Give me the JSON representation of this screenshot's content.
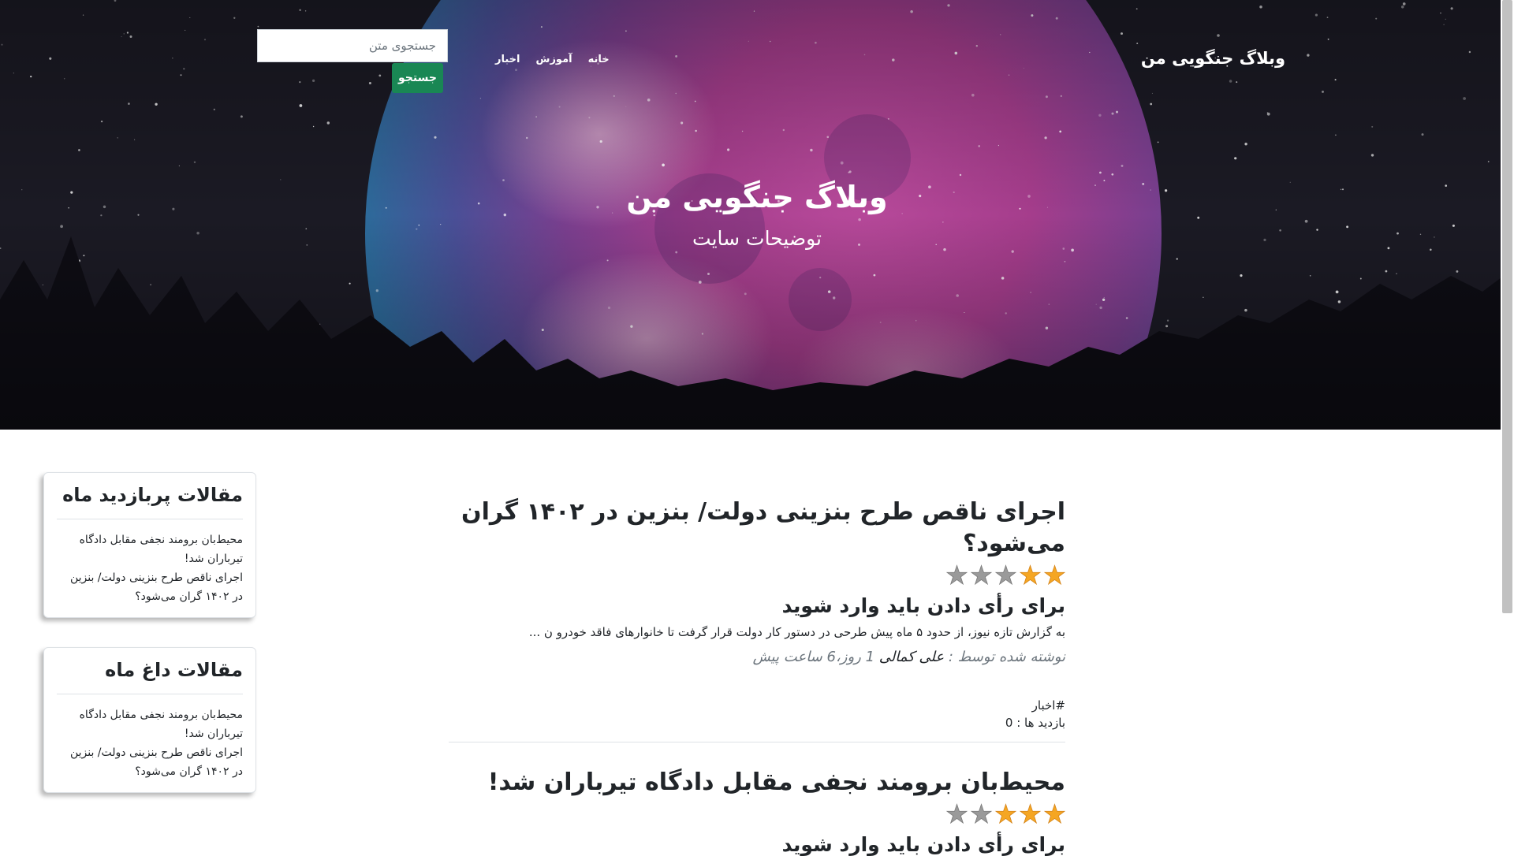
{
  "header": {
    "brand": "وبلاگ جنگویی من",
    "nav": [
      "خانه",
      "آموزش",
      "اخبار"
    ],
    "search_placeholder": "جستجوی متن",
    "search_button": "جستجو"
  },
  "hero": {
    "title": "وبلاگ جنگویی من",
    "subtitle": "توضیحات سایت"
  },
  "colors": {
    "search_button": "#198754",
    "star_filled": "#f5a623",
    "star_empty": "#9a9a9a"
  },
  "sidebar": [
    {
      "title": "مقالات پربازدید ماه",
      "items": [
        "محیط‌بان برومند نجفی مقابل دادگاه تیرباران شد!",
        "اجرای ناقص طرح بنزینی دولت/ بنزین در ۱۴۰۲ گران می‌شود؟"
      ]
    },
    {
      "title": "مقالات داغ ماه",
      "items": [
        "محیط‌بان برومند نجفی مقابل دادگاه تیرباران شد!",
        "اجرای ناقص طرح بنزینی دولت/ بنزین در ۱۴۰۲ گران می‌شود؟"
      ]
    }
  ],
  "posts": [
    {
      "title": "اجرای ناقص طرح بنزینی دولت/ بنزین در ۱۴۰۲ گران می‌شود؟",
      "rating": 2,
      "rating_max": 5,
      "vote_prompt": "برای رأی دادن باید وارد شوید",
      "excerpt": "به گزارش تازه نیوز، از حدود ۵ ماه پیش طرحی در دستور کار دولت قرار گرفت تا خانوارهای فاقد خودرو ن ...",
      "meta_prefix": "نوشته شده توسط :",
      "author": "علی کمالی",
      "time_ago": "1 روز،6 ساعت پیش",
      "tag": "#اخبار",
      "views": "بازدید ها : 0"
    },
    {
      "title": "محیط‌بان برومند نجفی مقابل دادگاه تیرباران شد!",
      "rating": 3,
      "rating_max": 5,
      "vote_prompt": "برای رأی دادن باید وارد شوید"
    }
  ]
}
